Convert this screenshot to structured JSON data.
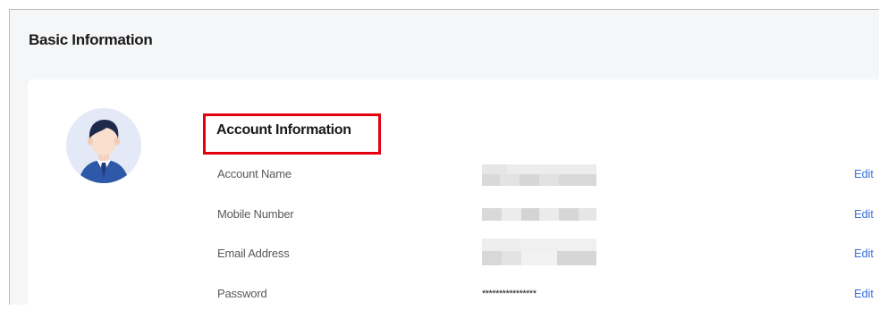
{
  "page": {
    "title": "Basic Information"
  },
  "account": {
    "section_title": "Account Information",
    "avatar_icon": "user-avatar-icon",
    "rows": [
      {
        "label": "Account Name",
        "value": "",
        "masked": true,
        "action": "Edit"
      },
      {
        "label": "Mobile Number",
        "value": "",
        "masked": true,
        "action": "Edit"
      },
      {
        "label": "Email Address",
        "value": "",
        "masked": true,
        "action": "Edit"
      },
      {
        "label": "Password",
        "value": "****************",
        "masked": false,
        "action": "Edit"
      }
    ]
  },
  "colors": {
    "accent_link": "#3a6fd8",
    "highlight_border": "#e3000f",
    "page_background": "#f5f6f8",
    "avatar_background": "#e4e9f7"
  }
}
